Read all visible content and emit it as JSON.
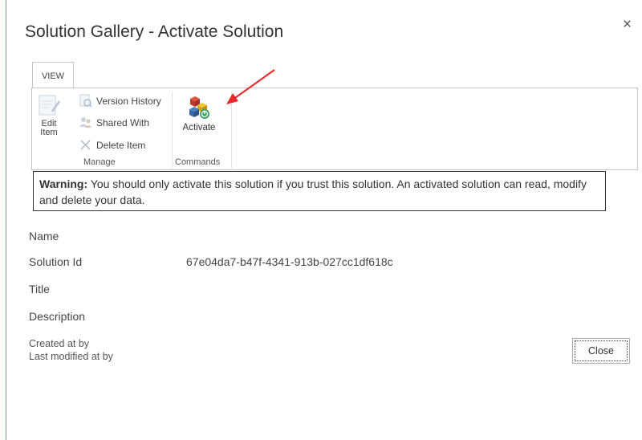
{
  "dialog": {
    "title": "Solution Gallery - Activate Solution",
    "close_symbol": "×"
  },
  "ribbon": {
    "tab_label": "VIEW",
    "edit_item_line1": "Edit",
    "edit_item_line2": "Item",
    "version_history": "Version History",
    "shared_with": "Shared With",
    "delete_item": "Delete Item",
    "manage_group": "Manage",
    "activate": "Activate",
    "commands_group": "Commands"
  },
  "warning": {
    "label": "Warning:",
    "text": " You should only activate this solution if you trust this solution. An activated solution can read, modify and delete your data."
  },
  "fields": {
    "name_label": "Name",
    "solution_id_label": "Solution Id",
    "solution_id_value": "67e04da7-b47f-4341-913b-027cc1df618c",
    "title_label": "Title",
    "description_label": "Description"
  },
  "meta": {
    "created": "Created at by",
    "modified": "Last modified at by"
  },
  "buttons": {
    "close": "Close"
  },
  "colors": {
    "annotation_arrow": "#e8282b",
    "border_accent": "#6b8fc7"
  }
}
